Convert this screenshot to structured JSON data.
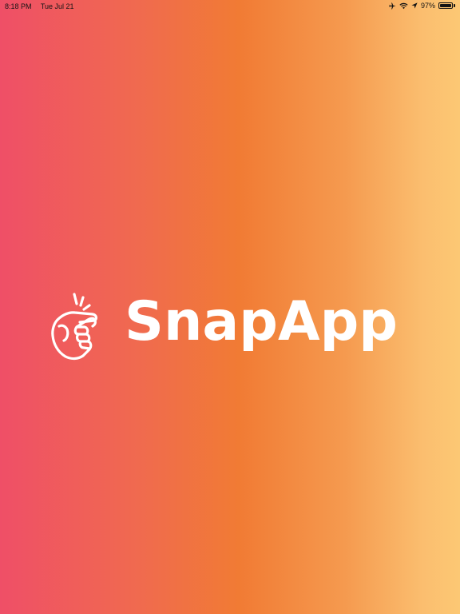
{
  "status_bar": {
    "time": "8:18 PM",
    "date": "Tue Jul 21",
    "battery_percent": "97%",
    "battery_level": 0.97,
    "icons": [
      "airplane-icon",
      "wifi-icon",
      "location-arrow-icon",
      "battery-icon"
    ]
  },
  "splash": {
    "app_name": "SnapApp",
    "logo_icon": "snapping-hand-icon",
    "text_color": "#ffffff"
  },
  "colors": {
    "gradient": [
      "#ef4f67",
      "#f17b34",
      "#fcc874"
    ]
  }
}
